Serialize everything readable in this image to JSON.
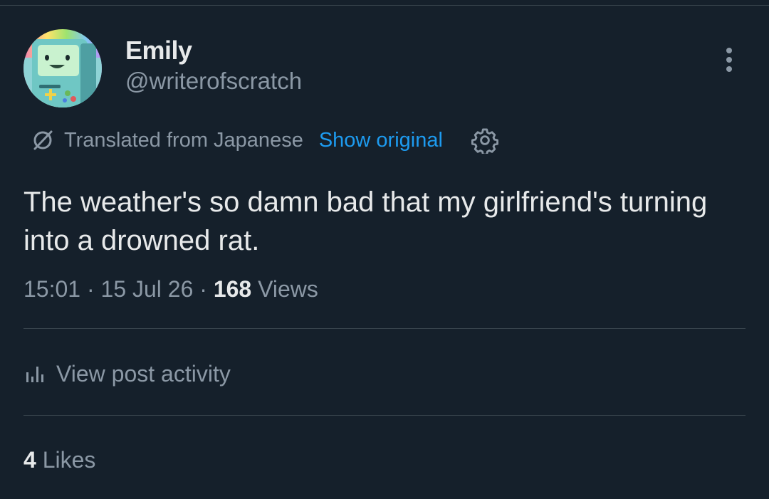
{
  "author": {
    "display_name": "Emily",
    "handle": "@writerofscratch",
    "avatar_icon": "bmo-avatar-icon"
  },
  "translation": {
    "label": "Translated from Japanese",
    "show_original_label": "Show original",
    "icon": "translate-icon",
    "settings_icon": "gear-icon"
  },
  "post": {
    "text": "The weather's so damn bad that my girlfriend's turning into a drowned rat."
  },
  "meta": {
    "time": "15:01",
    "separator": "·",
    "date": "15 Jul 26",
    "views_count": "168",
    "views_label": "Views"
  },
  "activity": {
    "label": "View post activity",
    "icon": "bar-chart-icon"
  },
  "likes": {
    "count": "4",
    "label": "Likes"
  },
  "colors": {
    "background": "#15202b",
    "accent": "#1d9bf0",
    "secondary_text": "#8b98a5",
    "primary_text": "#e7e9ea",
    "divider": "#38444d"
  }
}
